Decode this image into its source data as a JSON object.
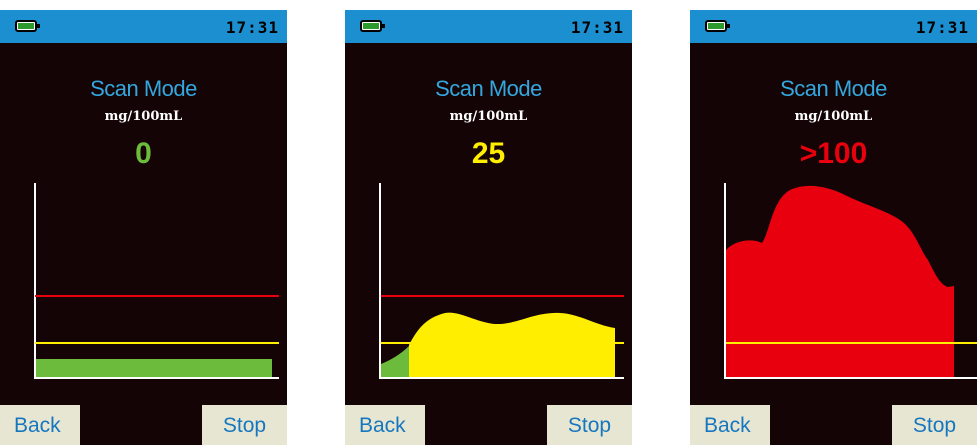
{
  "colors": {
    "status_bar": "#1c8fd0",
    "screen_bg": "#140406",
    "title": "#33a7de",
    "button_bg": "#e6e6d2",
    "button_text": "#1777be",
    "green": "#6dbb3c",
    "yellow": "#ffee00",
    "red": "#e8000e"
  },
  "screens": [
    {
      "status": {
        "battery_icon": "battery-icon",
        "time": "17:31"
      },
      "title": "Scan Mode",
      "unit": "mg/100mL",
      "reading": "0",
      "reading_color": "#6dbb3c",
      "buttons": {
        "back": "Back",
        "stop": "Stop"
      }
    },
    {
      "status": {
        "battery_icon": "battery-icon",
        "time": "17:31"
      },
      "title": "Scan Mode",
      "unit": "mg/100mL",
      "reading": "25",
      "reading_color": "#ffee00",
      "buttons": {
        "back": "Back",
        "stop": "Stop"
      }
    },
    {
      "status": {
        "battery_icon": "battery-icon",
        "time": "17:31"
      },
      "title": "Scan Mode",
      "unit": "mg/100mL",
      "reading": ">100",
      "reading_color": "#e8000e",
      "buttons": {
        "back": "Back",
        "stop": "Stop"
      }
    }
  ]
}
